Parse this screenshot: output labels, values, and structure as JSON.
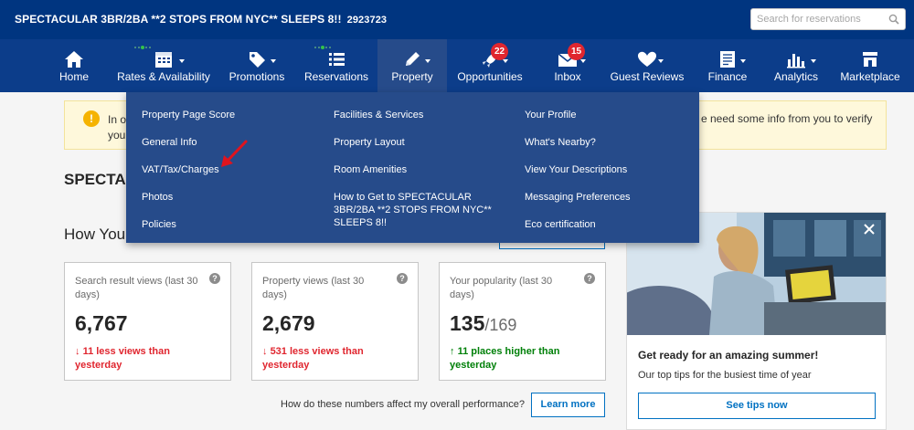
{
  "header": {
    "property_title": "SPECTACULAR 3BR/2BA **2 STOPS FROM NYC** SLEEPS 8!!",
    "property_id": "2923723",
    "search_placeholder": "Search for reservations"
  },
  "nav": {
    "items": [
      {
        "label": "Home",
        "icon": "home-icon"
      },
      {
        "label": "Rates & Availability",
        "icon": "calendar-icon"
      },
      {
        "label": "Promotions",
        "icon": "tag-icon"
      },
      {
        "label": "Reservations",
        "icon": "list-icon"
      },
      {
        "label": "Property",
        "icon": "pencil-icon",
        "active": true
      },
      {
        "label": "Opportunities",
        "icon": "rocket-icon",
        "badge": "22"
      },
      {
        "label": "Inbox",
        "icon": "envelope-icon",
        "badge": "15"
      },
      {
        "label": "Guest Reviews",
        "icon": "heart-icon"
      },
      {
        "label": "Finance",
        "icon": "document-icon"
      },
      {
        "label": "Analytics",
        "icon": "bar-chart-icon"
      },
      {
        "label": "Marketplace",
        "icon": "store-icon"
      }
    ],
    "accent_color": "#003580",
    "badge_color": "#e0262f"
  },
  "dropdown": {
    "col1": [
      "Property Page Score",
      "General Info",
      "VAT/Tax/Charges",
      "Photos",
      "Policies"
    ],
    "col2": [
      "Facilities & Services",
      "Property Layout",
      "Room Amenities",
      "How to Get to SPECTACULAR 3BR/2BA **2 STOPS FROM NYC** SLEEPS 8!!"
    ],
    "col3": [
      "Your Profile",
      "What's Nearby?",
      "View Your Descriptions",
      "Messaging Preferences",
      "Eco certification"
    ]
  },
  "alert": {
    "left_fragment_1": "In o",
    "left_fragment_2": "you",
    "right_fragment": "e need some info from you to verify"
  },
  "page": {
    "heading_fragment": "SPECTA",
    "subheading_fragment": "How You"
  },
  "stats": [
    {
      "title": "Search result views (last 30 days)",
      "value": "6,767",
      "of": "",
      "delta": "11 less views than yesterday",
      "direction": "down"
    },
    {
      "title": "Property views (last 30 days)",
      "value": "2,679",
      "of": "",
      "delta": "531 less views than yesterday",
      "direction": "down"
    },
    {
      "title": "Your popularity (last 30 days)",
      "value": "135",
      "of": "/169",
      "delta": "11 places higher than yesterday",
      "direction": "up"
    }
  ],
  "performance": {
    "question": "How do these numbers affect my overall performance?",
    "learn_more_label": "Learn more"
  },
  "promo": {
    "title": "Get ready for an amazing summer!",
    "subtitle": "Our top tips for the busiest time of year",
    "button_label": "See tips now"
  },
  "glyphs": {
    "warning": "!",
    "help": "?",
    "arrow_down": "↓",
    "arrow_up": "↑"
  }
}
